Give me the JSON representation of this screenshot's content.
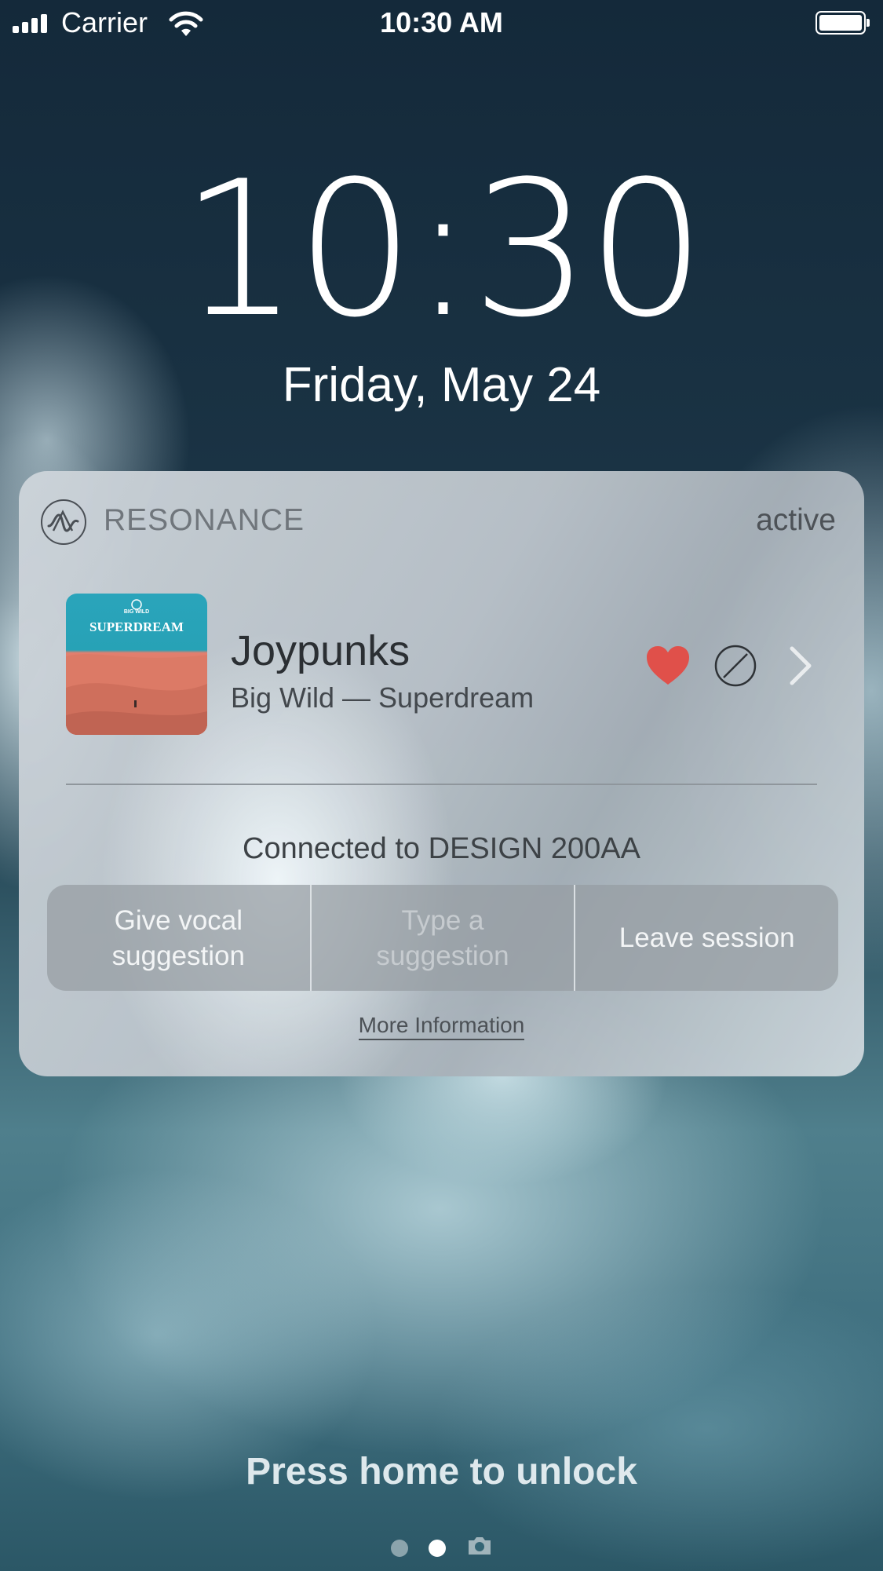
{
  "status_bar": {
    "carrier": "Carrier",
    "time": "10:30 AM"
  },
  "lock_screen": {
    "clock": "10:30",
    "date": "Friday, May 24",
    "unlock_hint": "Press home to unlock"
  },
  "notification": {
    "app_name": "RESONANCE",
    "status": "active",
    "album": {
      "small_label": "BIG WILD",
      "title": "SUPERDREAM"
    },
    "track": {
      "title": "Joypunks",
      "subtitle": "Big Wild — Superdream"
    },
    "connected_text": "Connected to DESIGN 200AA",
    "actions": [
      {
        "label": "Give vocal suggestion"
      },
      {
        "label": "Type a suggestion"
      },
      {
        "label": "Leave session"
      }
    ],
    "more_info": "More Information"
  },
  "colors": {
    "heart": "#e0504a",
    "card_bg": "#c4cbd1"
  }
}
